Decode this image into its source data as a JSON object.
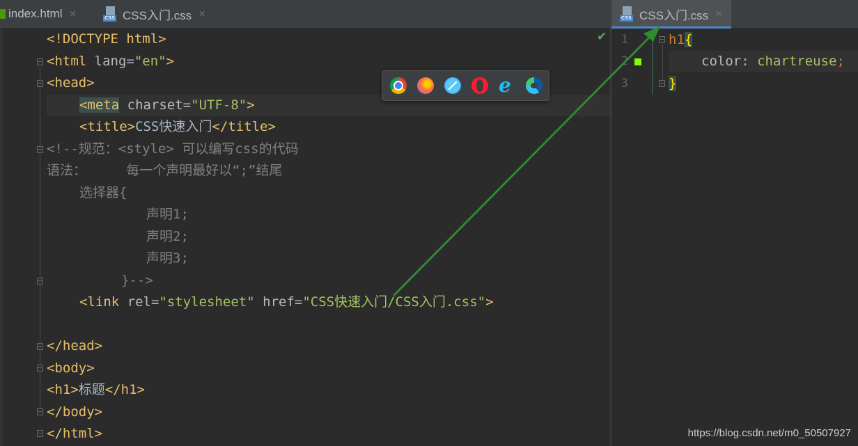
{
  "left_editor": {
    "tabs": [
      {
        "label": "index.html",
        "close": "×"
      },
      {
        "label": "CSS入门.css",
        "close": "×",
        "icon_text": "CSS"
      }
    ],
    "lines": {
      "l1_doctype": "<!DOCTYPE html>",
      "l2_open": "<html ",
      "l2_attr": "lang",
      "l2_eq": "=",
      "l2_val": "\"en\"",
      "l2_close": ">",
      "l3": "<head>",
      "l4_tag": "<meta",
      "l4_attr": " charset",
      "l4_eq": "=",
      "l4_val": "\"UTF-8\"",
      "l4_close": ">",
      "l5_open": "<title>",
      "l5_text": "CSS快速入门",
      "l5_close": "</title>",
      "l6": "<!--规范：<style> 可以编写css的代码",
      "l7": "语法：     每一个声明最好以“;”结尾",
      "l8": "选择器{",
      "l9": "声明1;",
      "l10": "声明2;",
      "l11": "声明3;",
      "l12": "}-->",
      "l13_open": "<link ",
      "l13_attr1": "rel",
      "l13_eq1": "=",
      "l13_val1": "\"stylesheet\"",
      "l13_attr2": " href",
      "l13_eq2": "=",
      "l13_val2": "\"CSS快速入门/CSS入门.css\"",
      "l13_close": ">",
      "l15": "</head>",
      "l16": "<body>",
      "l17_open": "<h1>",
      "l17_text": "标题",
      "l17_close": "</h1>",
      "l18": "</body>",
      "l19": "</html>"
    },
    "check_mark": "✔"
  },
  "browser_popup": {
    "icons": [
      "chrome-icon",
      "firefox-icon",
      "safari-icon",
      "opera-icon",
      "internet-explorer-icon",
      "edge-icon"
    ]
  },
  "right_editor": {
    "tab": {
      "label": "CSS入门.css",
      "close": "×",
      "icon_text": "CSS"
    },
    "line_numbers": [
      "1",
      "2",
      "3"
    ],
    "code": {
      "l1_sel": "h1",
      "l1_brace": "{",
      "l2_prop": "color",
      "l2_colon": ": ",
      "l2_val": "chartreuse",
      "l2_semi": ";",
      "l3_brace": "}"
    },
    "color_swatch": "#7fff00"
  },
  "colors": {
    "background": "#2b2b2b",
    "tag": "#e8bf6a",
    "attribute_value": "#a5c261",
    "comment": "#808080",
    "annotation_arrow": "#2e8b2e"
  },
  "watermark": "https://blog.csdn.net/m0_50507927"
}
